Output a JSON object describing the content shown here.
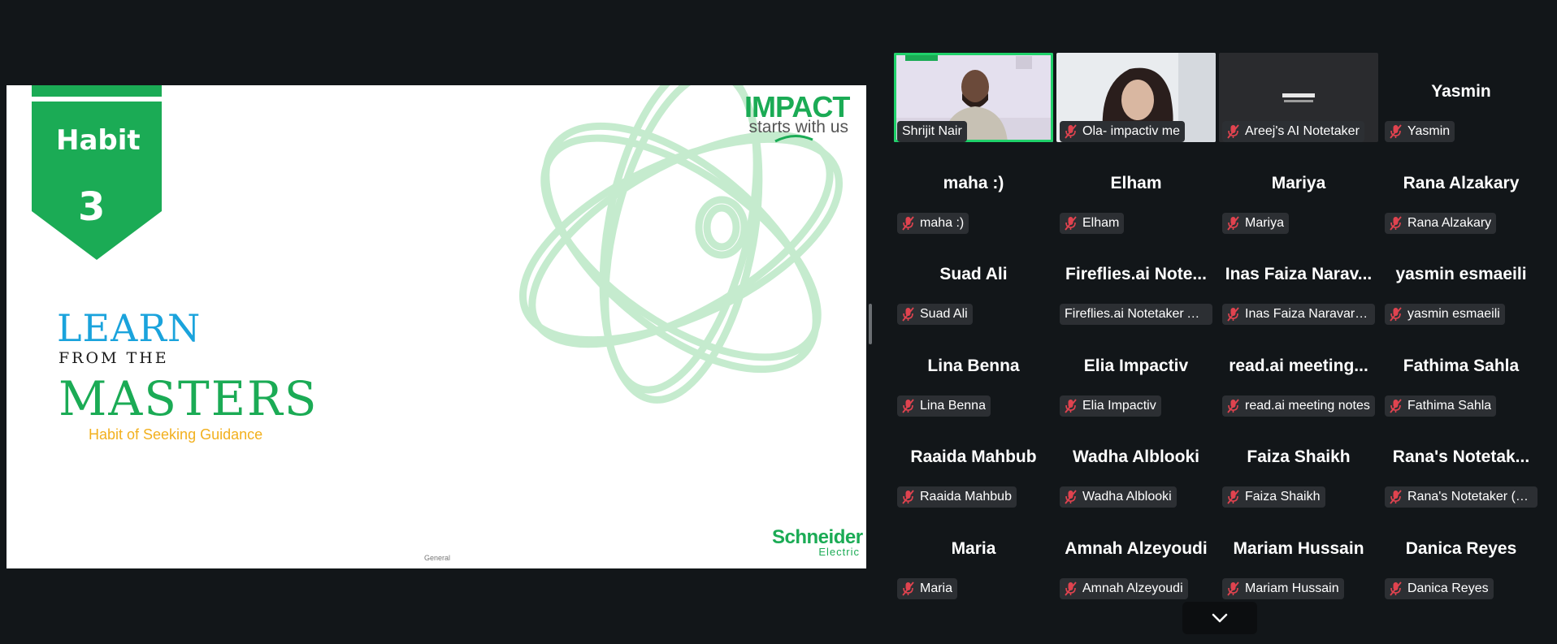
{
  "slide": {
    "habit_label": "Habit",
    "habit_number": "3",
    "title_line1": "LEARN",
    "title_line2": "FROM THE",
    "title_line3": "MASTERS",
    "subtitle": "Habit of Seeking Guidance",
    "footer_label": "General",
    "impact_logo_big": "IMPACT",
    "impact_logo_small": "starts with us",
    "brand_logo_line1": "Schneider",
    "brand_logo_line2": "Electric"
  },
  "participants": [
    {
      "display": "",
      "tag": "Shrijit Nair",
      "video": "camera",
      "muted": false
    },
    {
      "display": "",
      "tag": "Ola- impactiv me",
      "video": "camera",
      "muted": true
    },
    {
      "display": "",
      "tag": "Areej's AI Notetaker",
      "video": "bot",
      "muted": true
    },
    {
      "display": "Yasmin",
      "tag": "Yasmin",
      "muted": true
    },
    {
      "display": "maha :)",
      "tag": "maha :)",
      "muted": true
    },
    {
      "display": "Elham",
      "tag": "Elham",
      "muted": true
    },
    {
      "display": "Mariya",
      "tag": "Mariya",
      "muted": true
    },
    {
      "display": "Rana Alzakary",
      "tag": "Rana Alzakary",
      "muted": true
    },
    {
      "display": "Suad Ali",
      "tag": "Suad Ali",
      "muted": true
    },
    {
      "display": "Fireflies.ai Note...",
      "tag": "Fireflies.ai Notetaker Asma",
      "muted": false
    },
    {
      "display": "Inas Faiza Narav...",
      "tag": "Inas Faiza Naravar Mo...",
      "muted": true
    },
    {
      "display": "yasmin esmaeili",
      "tag": "yasmin esmaeili",
      "muted": true
    },
    {
      "display": "Lina Benna",
      "tag": "Lina Benna",
      "muted": true
    },
    {
      "display": "Elia Impactiv",
      "tag": "Elia Impactiv",
      "muted": true
    },
    {
      "display": "read.ai meeting...",
      "tag": "read.ai meeting notes",
      "muted": true
    },
    {
      "display": "Fathima Sahla",
      "tag": "Fathima Sahla",
      "muted": true
    },
    {
      "display": "Raaida Mahbub",
      "tag": "Raaida Mahbub",
      "muted": true
    },
    {
      "display": "Wadha Alblooki",
      "tag": "Wadha Alblooki",
      "muted": true
    },
    {
      "display": "Faiza Shaikh",
      "tag": "Faiza Shaikh",
      "muted": true
    },
    {
      "display": "Rana's Notetak...",
      "tag": "Rana's Notetaker (Otte...",
      "muted": true
    },
    {
      "display": "Maria",
      "tag": "Maria",
      "muted": true
    },
    {
      "display": "Amnah Alzeyoudi",
      "tag": "Amnah Alzeyoudi",
      "muted": true
    },
    {
      "display": "Mariam Hussain",
      "tag": "Mariam Hussain",
      "muted": true
    },
    {
      "display": "Danica Reyes",
      "tag": "Danica Reyes",
      "muted": true
    }
  ],
  "icons": {
    "mute": "microphone-muted-icon",
    "scroll_down": "chevron-down-icon"
  },
  "colors": {
    "active_speaker": "#1fd16a",
    "mute_red": "#e0434f",
    "brand_green": "#1bab55",
    "learn_blue": "#1aa3dc",
    "subtitle_yellow": "#f2b01e"
  }
}
